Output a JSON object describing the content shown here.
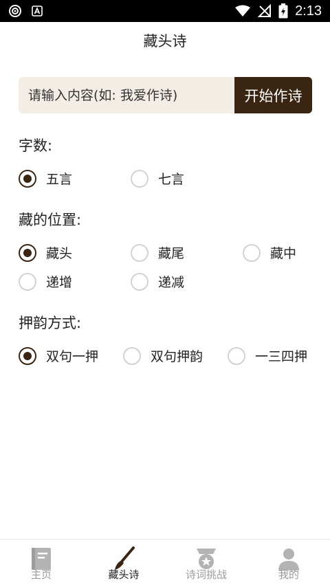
{
  "status_bar": {
    "time": "2:13",
    "icons": [
      "hotspot-icon",
      "app-notification-icon",
      "wifi-icon",
      "no-signal-icon",
      "battery-charging-icon"
    ]
  },
  "header": {
    "title": "藏头诗"
  },
  "input": {
    "placeholder": "请输入内容(如: 我爱作诗)",
    "value": ""
  },
  "start_button": {
    "label": "开始作诗"
  },
  "colors": {
    "accent": "#3a2412",
    "input_bg": "#f3ede6",
    "inactive": "#9a9a9a"
  },
  "sections": {
    "word_count": {
      "label": "字数:",
      "options": [
        {
          "label": "五言",
          "selected": true
        },
        {
          "label": "七言",
          "selected": false
        }
      ]
    },
    "position": {
      "label": "藏的位置:",
      "options": [
        {
          "label": "藏头",
          "selected": true
        },
        {
          "label": "藏尾",
          "selected": false
        },
        {
          "label": "藏中",
          "selected": false
        },
        {
          "label": "递增",
          "selected": false
        },
        {
          "label": "递减",
          "selected": false
        }
      ]
    },
    "rhyme": {
      "label": "押韵方式:",
      "options": [
        {
          "label": "双句一押",
          "selected": true
        },
        {
          "label": "双句押韵",
          "selected": false
        },
        {
          "label": "一三四押",
          "selected": false
        }
      ]
    }
  },
  "tabs": [
    {
      "label": "主页",
      "icon": "book-icon",
      "active": false
    },
    {
      "label": "藏头诗",
      "icon": "brush-icon",
      "active": true
    },
    {
      "label": "诗词挑战",
      "icon": "medal-icon",
      "active": false
    },
    {
      "label": "我的",
      "icon": "person-icon",
      "active": false
    }
  ]
}
